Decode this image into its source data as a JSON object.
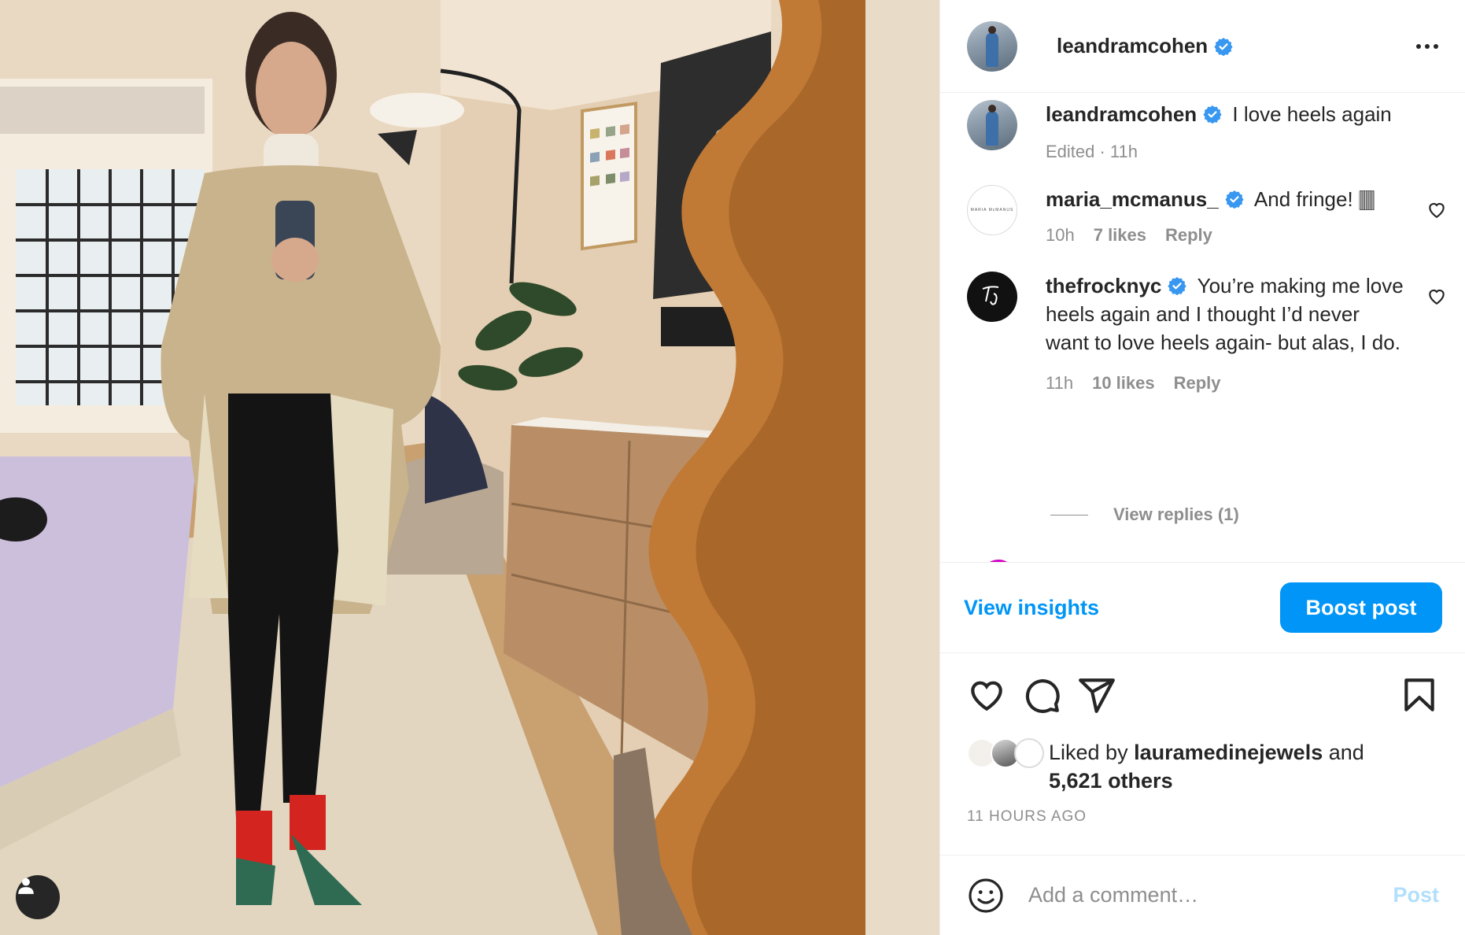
{
  "post": {
    "username": "leandramcohen",
    "verified": true,
    "more_icon": "more-horizontal-icon",
    "caption": {
      "username": "leandramcohen",
      "text": "I love heels again",
      "meta": "Edited · 11h"
    }
  },
  "comments": [
    {
      "username": "maria_mcmanus_",
      "avatar_text": "MARIA McMANUS",
      "text": "And fringe! 🀫",
      "time": "10h",
      "likes": "7 likes",
      "reply": "Reply"
    },
    {
      "username": "thefrocknyc",
      "avatar_text": "The Frock",
      "text": "You’re making me love heels again and I thought I’d never want to love heels again- but alas, I do.",
      "time": "11h",
      "likes": "10 likes",
      "reply": "Reply",
      "view_replies": "View replies (1)"
    }
  ],
  "insights": {
    "view_label": "View insights",
    "boost_label": "Boost post"
  },
  "likes_summary": {
    "prefix": "Liked by",
    "user": "lauramedinejewels",
    "and": "and",
    "others": "5,621 others"
  },
  "timestamp": "11 HOURS AGO",
  "add_comment": {
    "placeholder": "Add a comment…",
    "post_label": "Post"
  },
  "colors": {
    "accent": "#0095f6",
    "verified": "#3897f0",
    "muted": "#8e8e8e",
    "post_disabled": "#b2dffc"
  }
}
